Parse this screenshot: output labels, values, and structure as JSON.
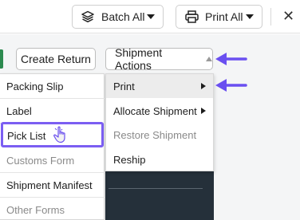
{
  "toolbar": {
    "batch_all_label": "Batch All",
    "print_all_label": "Print All",
    "close_glyph": "✕"
  },
  "actions": {
    "create_return_label": "Create Return",
    "shipment_actions_label": "Shipment Actions"
  },
  "print_submenu": {
    "items": [
      {
        "label": "Packing Slip",
        "disabled": false
      },
      {
        "label": "Label",
        "disabled": false
      },
      {
        "label": "Pick List",
        "disabled": false,
        "highlighted": true
      },
      {
        "label": "Customs Form",
        "disabled": true
      },
      {
        "label": "Shipment Manifest",
        "disabled": false
      },
      {
        "label": "Other Forms",
        "disabled": true
      }
    ]
  },
  "shipment_menu": {
    "items": [
      {
        "label": "Print",
        "has_submenu": true,
        "active": true
      },
      {
        "label": "Allocate Shipment",
        "has_submenu": true
      },
      {
        "label": "Restore Shipment",
        "disabled": true
      },
      {
        "label": "Reship"
      }
    ]
  },
  "colors": {
    "accent_purple": "#7b5ef2",
    "arrow_purple": "#6a4ff0",
    "disabled_text": "#8a8a8a",
    "green_status": "#2c8a4f",
    "dark_panel": "#25303a"
  }
}
